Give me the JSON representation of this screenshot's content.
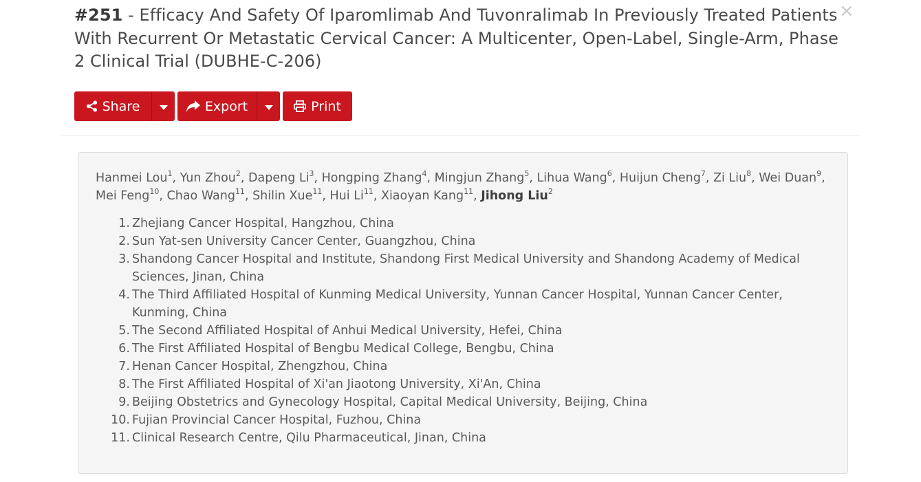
{
  "modal": {
    "title_number": "#251",
    "title_text": " - Efficacy And Safety Of Iparomlimab And Tuvonralimab In Previously Treated Patients With Recurrent Or Metastatic Cervical Cancer: A Multicenter, Open-Label, Single-Arm, Phase 2 Clinical Trial (DUBHE-C-206)",
    "close_label": "×"
  },
  "toolbar": {
    "share_label": "Share",
    "export_label": "Export",
    "print_label": "Print"
  },
  "icons": {
    "share": "share-icon",
    "export": "export-arrow-icon",
    "print": "printer-icon",
    "caret": "caret-down-icon"
  },
  "colors": {
    "accent": "#c9161f",
    "panel_bg": "#f5f5f5",
    "text": "#5a5a5a"
  },
  "authors": [
    {
      "name": "Hanmei Lou",
      "aff": "1",
      "sep": ", "
    },
    {
      "name": "Yun Zhou",
      "aff": "2",
      "sep": ", "
    },
    {
      "name": "Dapeng Li",
      "aff": "3",
      "sep": ", "
    },
    {
      "name": "Hongping Zhang",
      "aff": "4",
      "sep": ", "
    },
    {
      "name": "Mingjun Zhang",
      "aff": "5",
      "sep": ", "
    },
    {
      "name": "Lihua Wang",
      "aff": "6",
      "sep": ", "
    },
    {
      "name": "Huijun Cheng",
      "aff": "7",
      "sep": ", "
    },
    {
      "name": "Zi Liu",
      "aff": "8",
      "sep": ", "
    },
    {
      "name": "Wei Duan",
      "aff": "9",
      "sep": ", "
    },
    {
      "name": "Mei Feng",
      "aff": "10",
      "sep": ", "
    },
    {
      "name": "Chao Wang",
      "aff": "11",
      "sep": ", "
    },
    {
      "name": "Shilin Xue",
      "aff": "11",
      "sep": ", "
    },
    {
      "name": "Hui Li",
      "aff": "11",
      "sep": ", "
    },
    {
      "name": "Xiaoyan Kang",
      "aff": "11",
      "sep": ", "
    },
    {
      "name": "Jihong Liu",
      "aff": "2",
      "sep": ""
    }
  ],
  "affiliations": [
    {
      "num": "1.",
      "text": "Zhejiang Cancer Hospital, Hangzhou, China"
    },
    {
      "num": "2.",
      "text": "Sun Yat-sen University Cancer Center, Guangzhou, China"
    },
    {
      "num": "3.",
      "text": "Shandong Cancer Hospital and Institute, Shandong First Medical University and Shandong Academy of Medical Sciences, Jinan, China"
    },
    {
      "num": "4.",
      "text": "The Third Affiliated Hospital of Kunming Medical University, Yunnan Cancer Hospital, Yunnan Cancer Center, Kunming, China"
    },
    {
      "num": "5.",
      "text": "The Second Affiliated Hospital of Anhui Medical University, Hefei, China"
    },
    {
      "num": "6.",
      "text": "The First Affiliated Hospital of Bengbu Medical College, Bengbu, China"
    },
    {
      "num": "7.",
      "text": "Henan Cancer Hospital, Zhengzhou, China"
    },
    {
      "num": "8.",
      "text": "The First Affiliated Hospital of Xi'an Jiaotong University, Xi'An, China"
    },
    {
      "num": "9.",
      "text": "Beijing Obstetrics and Gynecology Hospital, Capital Medical University, Beijing, China"
    },
    {
      "num": "10.",
      "text": "Fujian Provincial Cancer Hospital, Fuzhou, China"
    },
    {
      "num": "11.",
      "text": "Clinical Research Centre, Qilu Pharmaceutical, Jinan, China"
    }
  ]
}
